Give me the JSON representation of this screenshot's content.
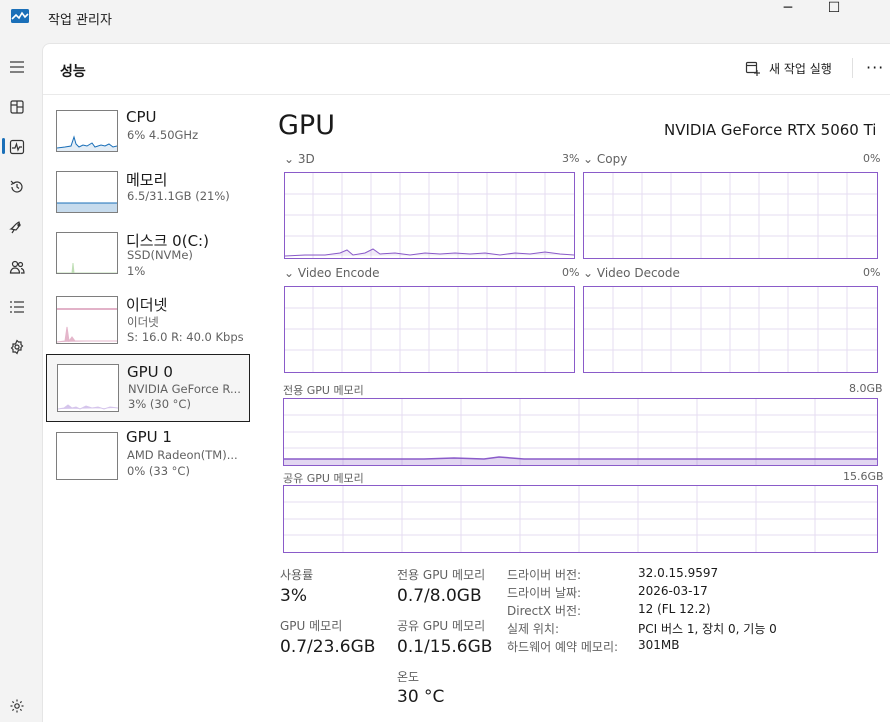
{
  "window": {
    "title": "작업 관리자",
    "minimize_label": "─",
    "maximize_label": "☐"
  },
  "header": {
    "page_title": "성능",
    "new_task_label": "새 작업 실행",
    "more_label": "···"
  },
  "nav_rail": [
    {
      "icon": "hamburger-icon"
    },
    {
      "icon": "processes-icon"
    },
    {
      "icon": "performance-icon"
    },
    {
      "icon": "app-history-icon"
    },
    {
      "icon": "startup-apps-icon"
    },
    {
      "icon": "users-icon"
    },
    {
      "icon": "details-icon"
    },
    {
      "icon": "services-icon"
    },
    {
      "icon": "settings-icon"
    }
  ],
  "devices": [
    {
      "name": "CPU",
      "lines": [
        "6% 4.50GHz"
      ],
      "color": "#1a6fb8"
    },
    {
      "name": "메모리",
      "lines": [
        "6.5/31.1GB (21%)"
      ],
      "color": "#1a6fb8"
    },
    {
      "name": "디스크 0(C:)",
      "lines": [
        "SSD(NVMe)",
        "1%"
      ],
      "color": "#4aa32f"
    },
    {
      "name": "이더넷",
      "lines": [
        "이더넷",
        "S: 16.0  R: 40.0 Kbps"
      ],
      "color": "#b3306c"
    },
    {
      "name": "GPU 0",
      "lines": [
        "NVIDIA GeForce R...",
        "3%  (30 °C)"
      ],
      "color": "#8a5bc9",
      "selected": true
    },
    {
      "name": "GPU 1",
      "lines": [
        "AMD Radeon(TM)...",
        "0%  (33 °C)"
      ],
      "color": "#8a5bc9"
    }
  ],
  "gpu": {
    "title": "GPU",
    "model": "NVIDIA GeForce RTX 5060 Ti",
    "engines": [
      {
        "name": "3D",
        "pct": "3%",
        "chevron": "⌄"
      },
      {
        "name": "Copy",
        "pct": "0%",
        "chevron": "⌄"
      },
      {
        "name": "Video Encode",
        "pct": "0%",
        "chevron": "⌄"
      },
      {
        "name": "Video Decode",
        "pct": "0%",
        "chevron": "⌄"
      }
    ],
    "dedicated_memory": {
      "label": "전용 GPU 메모리",
      "max": "8.0GB"
    },
    "shared_memory": {
      "label": "공유 GPU 메모리",
      "max": "15.6GB"
    },
    "stats": {
      "utilization": {
        "label": "사용률",
        "value": "3%"
      },
      "gpu_memory": {
        "label": "GPU 메모리",
        "value": "0.7/23.6GB"
      },
      "dedicated": {
        "label": "전용 GPU 메모리",
        "value": "0.7/8.0GB"
      },
      "shared": {
        "label": "공유 GPU 메모리",
        "value": "0.1/15.6GB"
      },
      "temperature": {
        "label": "온도",
        "value": "30 °C"
      }
    },
    "details": [
      {
        "k": "드라이버 버전:",
        "v": "32.0.15.9597"
      },
      {
        "k": "드라이버 날짜:",
        "v": "2026-03-17"
      },
      {
        "k": "DirectX 버전:",
        "v": "12 (FL 12.2)"
      },
      {
        "k": "실제 위치:",
        "v": "PCI 버스 1, 장치 0, 기능 0"
      },
      {
        "k": "하드웨어 예약 메모리:",
        "v": "301MB"
      }
    ]
  }
}
